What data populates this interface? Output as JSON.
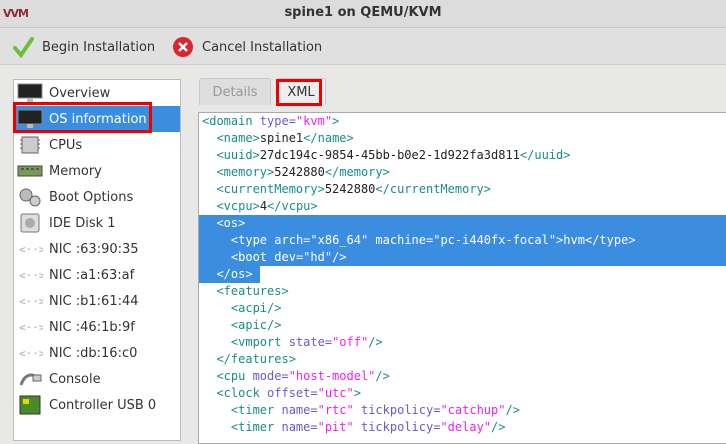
{
  "window": {
    "title": "spine1 on QEMU/KVM",
    "logo": "VM"
  },
  "toolbar": {
    "begin": "Begin Installation",
    "cancel": "Cancel Installation"
  },
  "sidebar": {
    "items": [
      {
        "label": "Overview",
        "icon": "monitor-icon"
      },
      {
        "label": "OS information",
        "icon": "monitor-icon",
        "selected": true
      },
      {
        "label": "CPUs",
        "icon": "cpu-icon"
      },
      {
        "label": "Memory",
        "icon": "memory-icon"
      },
      {
        "label": "Boot Options",
        "icon": "gear-icon"
      },
      {
        "label": "IDE Disk 1",
        "icon": "disk-icon"
      },
      {
        "label": "NIC :63:90:35",
        "icon": "nic-icon"
      },
      {
        "label": "NIC :a1:63:af",
        "icon": "nic-icon"
      },
      {
        "label": "NIC :b1:61:44",
        "icon": "nic-icon"
      },
      {
        "label": "NIC :46:1b:9f",
        "icon": "nic-icon"
      },
      {
        "label": "NIC :db:16:c0",
        "icon": "nic-icon"
      },
      {
        "label": "Console",
        "icon": "console-icon"
      },
      {
        "label": "Controller USB 0",
        "icon": "usb-controller-icon"
      }
    ]
  },
  "tabs": [
    {
      "label": "Details",
      "active": false
    },
    {
      "label": "XML",
      "active": true
    }
  ],
  "xml": {
    "lines": [
      {
        "ind": 0,
        "t": [
          [
            "tag",
            "<domain "
          ],
          [
            "attr",
            "type="
          ],
          [
            "val",
            "\"kvm\""
          ],
          [
            "tag",
            ">"
          ]
        ]
      },
      {
        "ind": 1,
        "t": [
          [
            "tag",
            "<name>"
          ],
          [
            "txt",
            "spine1"
          ],
          [
            "tag",
            "</name>"
          ]
        ]
      },
      {
        "ind": 1,
        "t": [
          [
            "tag",
            "<uuid>"
          ],
          [
            "txt",
            "27dc194c-9854-45bb-b0e2-1d922fa3d811"
          ],
          [
            "tag",
            "</uuid>"
          ]
        ]
      },
      {
        "ind": 1,
        "t": [
          [
            "tag",
            "<memory>"
          ],
          [
            "txt",
            "5242880"
          ],
          [
            "tag",
            "</memory>"
          ]
        ]
      },
      {
        "ind": 1,
        "t": [
          [
            "tag",
            "<currentMemory>"
          ],
          [
            "txt",
            "5242880"
          ],
          [
            "tag",
            "</currentMemory>"
          ]
        ]
      },
      {
        "ind": 1,
        "t": [
          [
            "tag",
            "<vcpu>"
          ],
          [
            "txt",
            "4"
          ],
          [
            "tag",
            "</vcpu>"
          ]
        ]
      },
      {
        "ind": 1,
        "sel": "full",
        "t": [
          [
            "tag",
            "<os>"
          ]
        ]
      },
      {
        "ind": 2,
        "sel": "full",
        "t": [
          [
            "tag",
            "<type "
          ],
          [
            "attr",
            "arch="
          ],
          [
            "val",
            "\"x86_64\" "
          ],
          [
            "attr",
            "machine="
          ],
          [
            "val",
            "\"pc-i440fx-focal\""
          ],
          [
            "tag",
            ">"
          ],
          [
            "txt",
            "hvm"
          ],
          [
            "tag",
            "</type>"
          ]
        ]
      },
      {
        "ind": 2,
        "sel": "full",
        "t": [
          [
            "tag",
            "<boot "
          ],
          [
            "attr",
            "dev="
          ],
          [
            "val",
            "\"hd\""
          ],
          [
            "tag",
            "/>"
          ]
        ]
      },
      {
        "ind": 1,
        "sel": "partial",
        "t": [
          [
            "tag",
            "</os>"
          ]
        ]
      },
      {
        "ind": 1,
        "t": [
          [
            "tag",
            "<features>"
          ]
        ]
      },
      {
        "ind": 2,
        "t": [
          [
            "tag",
            "<acpi/>"
          ]
        ]
      },
      {
        "ind": 2,
        "t": [
          [
            "tag",
            "<apic/>"
          ]
        ]
      },
      {
        "ind": 2,
        "t": [
          [
            "tag",
            "<vmport "
          ],
          [
            "attr",
            "state="
          ],
          [
            "val",
            "\"off\""
          ],
          [
            "tag",
            "/>"
          ]
        ]
      },
      {
        "ind": 1,
        "t": [
          [
            "tag",
            "</features>"
          ]
        ]
      },
      {
        "ind": 1,
        "t": [
          [
            "tag",
            "<cpu "
          ],
          [
            "attr",
            "mode="
          ],
          [
            "val",
            "\"host-model\""
          ],
          [
            "tag",
            "/>"
          ]
        ]
      },
      {
        "ind": 1,
        "t": [
          [
            "tag",
            "<clock "
          ],
          [
            "attr",
            "offset="
          ],
          [
            "val",
            "\"utc\""
          ],
          [
            "tag",
            ">"
          ]
        ]
      },
      {
        "ind": 2,
        "t": [
          [
            "tag",
            "<timer "
          ],
          [
            "attr",
            "name="
          ],
          [
            "val",
            "\"rtc\" "
          ],
          [
            "attr",
            "tickpolicy="
          ],
          [
            "val",
            "\"catchup\""
          ],
          [
            "tag",
            "/>"
          ]
        ]
      },
      {
        "ind": 2,
        "t": [
          [
            "tag",
            "<timer "
          ],
          [
            "attr",
            "name="
          ],
          [
            "val",
            "\"pit\" "
          ],
          [
            "attr",
            "tickpolicy="
          ],
          [
            "val",
            "\"delay\""
          ],
          [
            "tag",
            "/>"
          ]
        ]
      }
    ]
  }
}
